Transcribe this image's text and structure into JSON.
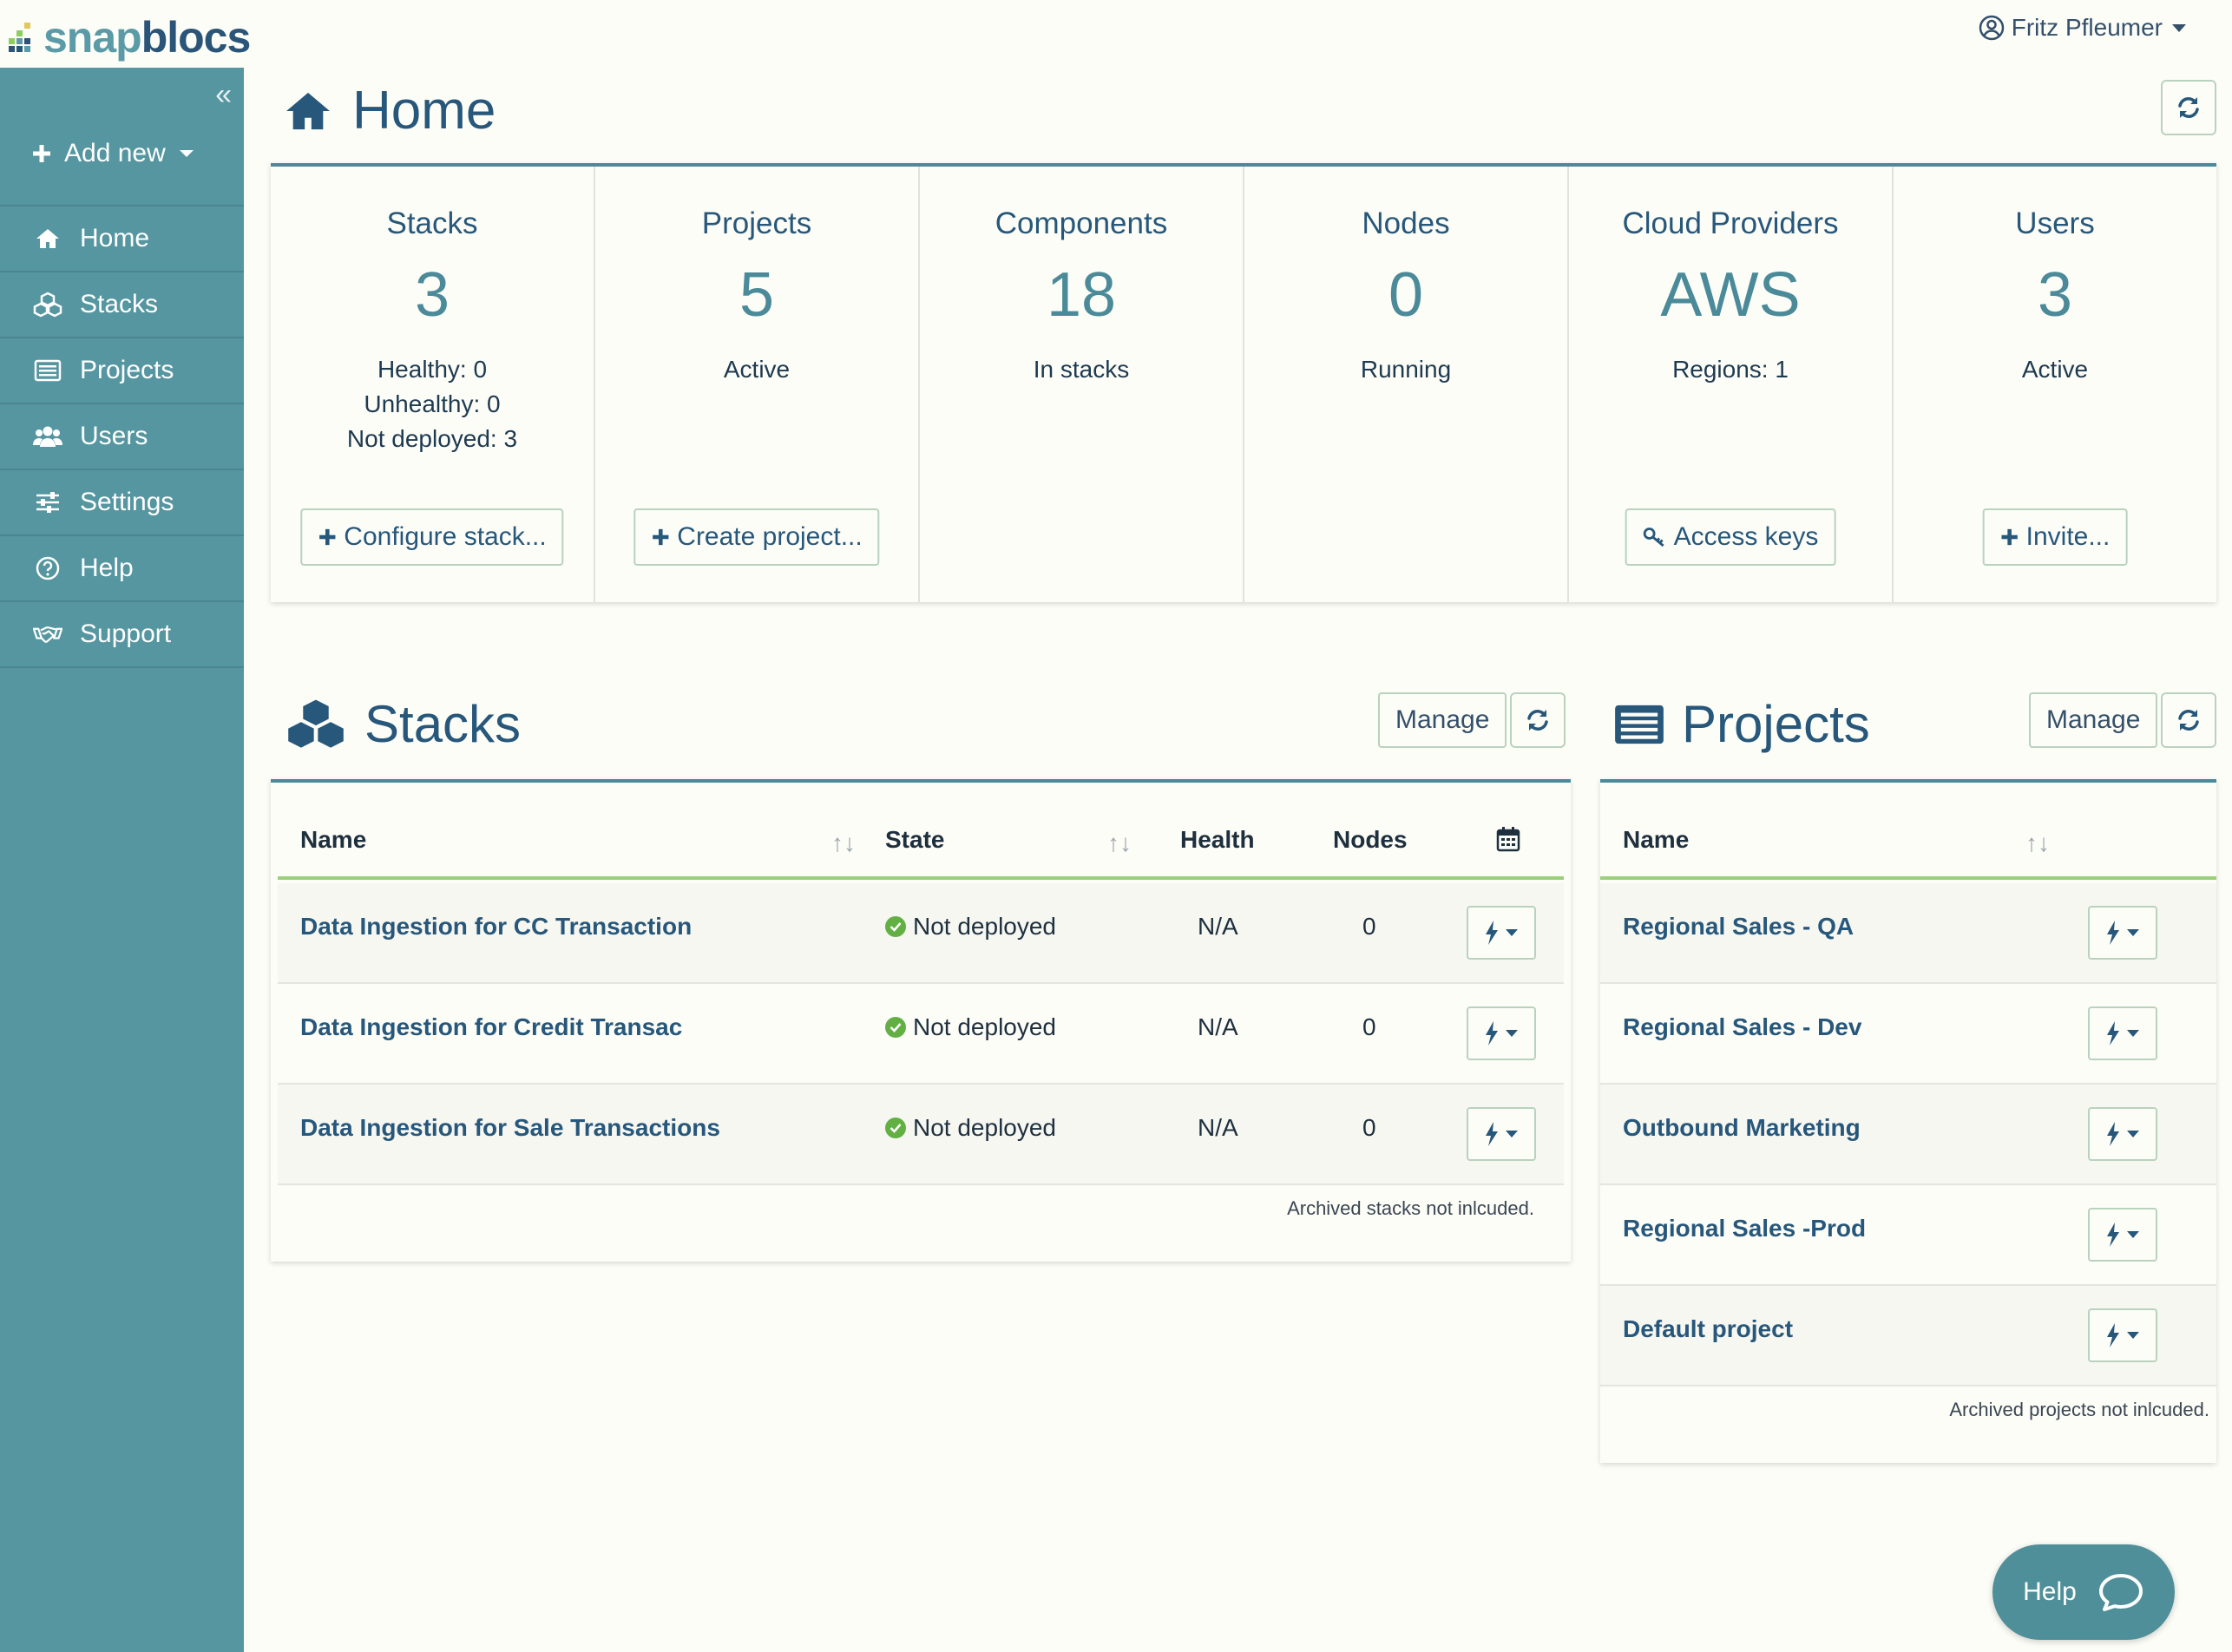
{
  "brand": {
    "logo_part1": "snap",
    "logo_part2": "blocs"
  },
  "user": {
    "name": "Fritz Pfleumer"
  },
  "sidebar": {
    "add_new_label": "Add new",
    "items": [
      {
        "label": "Home",
        "icon": "home-icon"
      },
      {
        "label": "Stacks",
        "icon": "cubes-icon"
      },
      {
        "label": "Projects",
        "icon": "list-icon"
      },
      {
        "label": "Users",
        "icon": "users-icon"
      },
      {
        "label": "Settings",
        "icon": "sliders-icon"
      },
      {
        "label": "Help",
        "icon": "question-circle-icon"
      },
      {
        "label": "Support",
        "icon": "handshake-icon"
      }
    ]
  },
  "page": {
    "title": "Home"
  },
  "summary": [
    {
      "label": "Stacks",
      "value": "3",
      "sub": [
        "Healthy: 0",
        "Unhealthy: 0",
        "Not deployed: 3"
      ],
      "action": "Configure stack..."
    },
    {
      "label": "Projects",
      "value": "5",
      "sub": [
        "Active"
      ],
      "action": "Create project..."
    },
    {
      "label": "Components",
      "value": "18",
      "sub": [
        "In stacks"
      ],
      "action": ""
    },
    {
      "label": "Nodes",
      "value": "0",
      "sub": [
        "Running"
      ],
      "action": ""
    },
    {
      "label": "Cloud Providers",
      "value": "AWS",
      "sub": [
        "Regions: 1"
      ],
      "action": "Access keys"
    },
    {
      "label": "Users",
      "value": "3",
      "sub": [
        "Active"
      ],
      "action": "Invite..."
    }
  ],
  "stacks": {
    "title": "Stacks",
    "manage_label": "Manage",
    "columns": {
      "name": "Name",
      "state": "State",
      "health": "Health",
      "nodes": "Nodes"
    },
    "rows": [
      {
        "name": "Data Ingestion for CC Transaction",
        "state": "Not deployed",
        "health": "N/A",
        "nodes": "0"
      },
      {
        "name": "Data Ingestion for Credit Transac",
        "state": "Not deployed",
        "health": "N/A",
        "nodes": "0"
      },
      {
        "name": "Data Ingestion for Sale Transactions",
        "state": "Not deployed",
        "health": "N/A",
        "nodes": "0"
      }
    ],
    "note": "Archived stacks not inlcuded."
  },
  "projects": {
    "title": "Projects",
    "manage_label": "Manage",
    "columns": {
      "name": "Name"
    },
    "rows": [
      {
        "name": "Regional Sales - QA"
      },
      {
        "name": "Regional Sales - Dev"
      },
      {
        "name": "Outbound Marketing"
      },
      {
        "name": "Regional Sales -Prod"
      },
      {
        "name": "Default project"
      }
    ],
    "note": "Archived projects not inlcuded."
  },
  "help_widget": {
    "label": "Help"
  },
  "colors": {
    "sidebar": "#5596a0",
    "accent": "#27577a",
    "teal": "#4a8a99",
    "ok": "#62b044"
  }
}
